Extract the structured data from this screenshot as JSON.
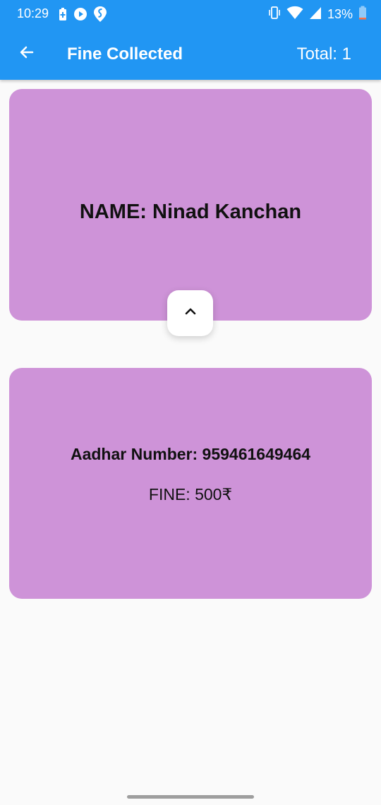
{
  "status_bar": {
    "time": "10:29",
    "battery_percent": "13%",
    "left_icons": [
      "battery-saver-icon",
      "play-icon",
      "swiggy-icon"
    ],
    "right_icons": [
      "vibrate-icon",
      "wifi-icon",
      "signal-icon",
      "battery-icon"
    ]
  },
  "appbar": {
    "title": "Fine Collected",
    "total_label": "Total: 1",
    "back_icon": "arrow-left-icon",
    "background_color": "#2196f3"
  },
  "record": {
    "name_line": "NAME: Ninad Kanchan",
    "aadhar_line": "Aadhar Number: 959461649464",
    "fine_line": "FINE: 500₹",
    "card_color": "#ce93d8",
    "collapse_icon": "chevron-up-icon"
  }
}
